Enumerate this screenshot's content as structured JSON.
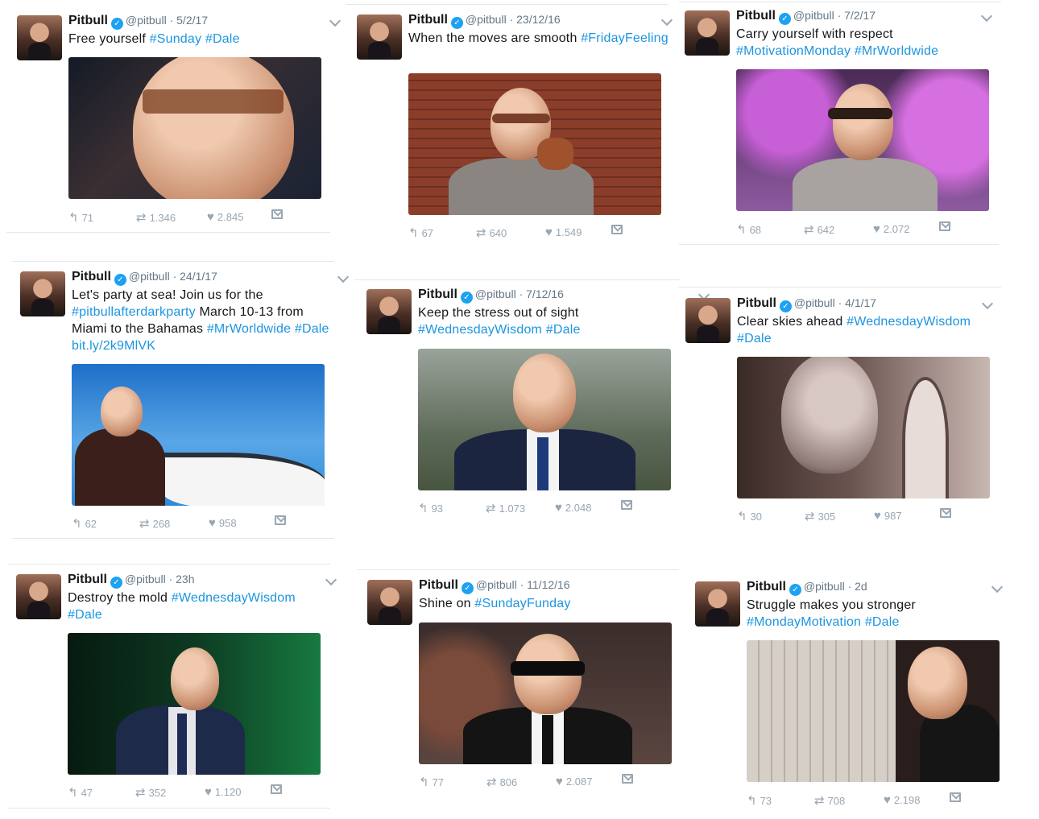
{
  "tweets": [
    {
      "name": "Pitbull",
      "handle": "@pitbull",
      "date": "5/2/17",
      "text": [
        {
          "t": "Free yourself "
        },
        {
          "t": "#Sunday",
          "tag": true
        },
        {
          "t": " "
        },
        {
          "t": "#Dale",
          "tag": true
        }
      ],
      "replies": "71",
      "retweets": "1.346",
      "likes": "2.845"
    },
    {
      "name": "Pitbull",
      "handle": "@pitbull",
      "date": "23/12/16",
      "text": [
        {
          "t": "When the moves are smooth "
        },
        {
          "t": "#FridayFeeling",
          "tag": true
        }
      ],
      "replies": "67",
      "retweets": "640",
      "likes": "1.549"
    },
    {
      "name": "Pitbull",
      "handle": "@pitbull",
      "date": "7/2/17",
      "text": [
        {
          "t": "Carry yourself with respect "
        },
        {
          "t": "#MotivationMonday",
          "tag": true
        },
        {
          "t": " "
        },
        {
          "t": "#MrWorldwide",
          "tag": true
        }
      ],
      "replies": "68",
      "retweets": "642",
      "likes": "2.072"
    },
    {
      "name": "Pitbull",
      "handle": "@pitbull",
      "date": "24/1/17",
      "text": [
        {
          "t": "Let's party at sea! Join us for the "
        },
        {
          "t": "#pitbullafterdarkparty",
          "tag": true
        },
        {
          "t": " March 10-13 from Miami to the Bahamas "
        },
        {
          "t": "#MrWorldwide",
          "tag": true
        },
        {
          "t": " "
        },
        {
          "t": "#Dale",
          "tag": true
        },
        {
          "t": " "
        },
        {
          "t": "bit.ly/2k9MlVK",
          "tag": true
        }
      ],
      "replies": "62",
      "retweets": "268",
      "likes": "958"
    },
    {
      "name": "Pitbull",
      "handle": "@pitbull",
      "date": "7/12/16",
      "text": [
        {
          "t": "Keep the stress out of sight "
        },
        {
          "t": "#WednesdayWisdom",
          "tag": true
        },
        {
          "t": " "
        },
        {
          "t": "#Dale",
          "tag": true
        }
      ],
      "replies": "93",
      "retweets": "1.073",
      "likes": "2.048"
    },
    {
      "name": "Pitbull",
      "handle": "@pitbull",
      "date": "4/1/17",
      "text": [
        {
          "t": "Clear skies ahead "
        },
        {
          "t": "#WednesdayWisdom",
          "tag": true
        },
        {
          "t": " "
        },
        {
          "t": "#Dale",
          "tag": true
        }
      ],
      "replies": "30",
      "retweets": "305",
      "likes": "987"
    },
    {
      "name": "Pitbull",
      "handle": "@pitbull",
      "date": "23h",
      "text": [
        {
          "t": "Destroy the mold "
        },
        {
          "t": "#WednesdayWisdom",
          "tag": true
        },
        {
          "t": " "
        },
        {
          "t": "#Dale",
          "tag": true
        }
      ],
      "replies": "47",
      "retweets": "352",
      "likes": "1.120"
    },
    {
      "name": "Pitbull",
      "handle": "@pitbull",
      "date": "11/12/16",
      "text": [
        {
          "t": "Shine on  "
        },
        {
          "t": "#SundayFunday",
          "tag": true
        }
      ],
      "replies": "77",
      "retweets": "806",
      "likes": "2.087"
    },
    {
      "name": "Pitbull",
      "handle": "@pitbull",
      "date": "2d",
      "text": [
        {
          "t": "Struggle makes you stronger "
        },
        {
          "t": "#MondayMotivation",
          "tag": true
        },
        {
          "t": " "
        },
        {
          "t": "#Dale",
          "tag": true
        }
      ],
      "replies": "73",
      "retweets": "708",
      "likes": "2.198"
    }
  ],
  "icons": {
    "reply": "reply-icon",
    "retweet": "retweet-icon",
    "like": "heart-icon",
    "message": "envelope-icon",
    "verified": "verified-badge-icon",
    "menu": "chevron-down-icon"
  },
  "colors": {
    "hashtag": "#1b95e0",
    "meta": "#657786",
    "action": "#9aa6b1",
    "verified": "#1da1f2"
  }
}
